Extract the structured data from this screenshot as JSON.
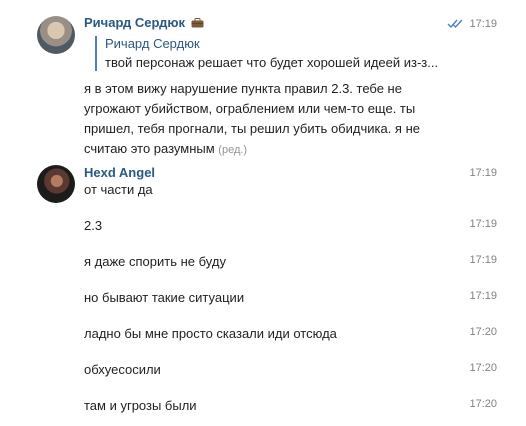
{
  "messages": [
    {
      "author": "Ричард Сердюк",
      "time": "17:19",
      "reply": {
        "author": "Ричард Сердюк",
        "text": "твой персонаж решает что будет хорошей идеей из-з..."
      },
      "text": "я в этом вижу нарушение пункта правил 2.3. тебе не угрожают убийством, ограблением или чем-то еще. ты пришел, тебя прогнали, ты решил убить обидчика. я не считаю это разумным",
      "edited": "(ред.)"
    },
    {
      "author": "Hexd Angel",
      "lines": [
        {
          "text": "от части да",
          "time": "17:19"
        },
        {
          "text": "2.3",
          "time": "17:19"
        },
        {
          "text": "я даже спорить не буду",
          "time": "17:19"
        },
        {
          "text": "но бывают такие ситуации",
          "time": "17:19"
        },
        {
          "text": "ладно бы мне просто сказали иди отсюда",
          "time": "17:20"
        },
        {
          "text": "обхуесосили",
          "time": "17:20"
        },
        {
          "text": "там и угрозы были",
          "time": "17:20"
        }
      ]
    }
  ],
  "icons": {
    "badge": "briefcase-icon",
    "read_status": "double-check-icon"
  },
  "colors": {
    "author": "#2a5885",
    "time": "#828282",
    "reply_bar": "#5181b8",
    "check": "#5181b8"
  }
}
